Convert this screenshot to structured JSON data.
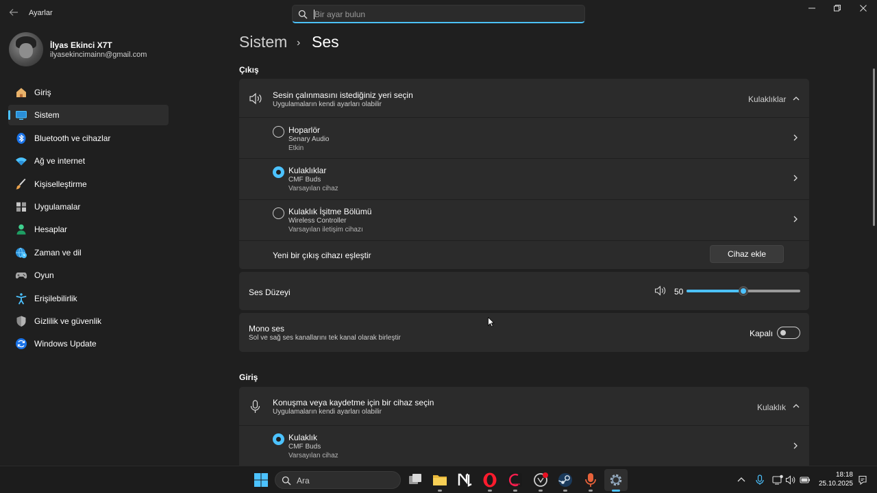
{
  "app": {
    "title": "Ayarlar",
    "back_icon": "back-arrow-icon",
    "window_controls": [
      "minimize",
      "maximize",
      "close"
    ]
  },
  "search": {
    "placeholder": "Bir ayar bulun",
    "value": ""
  },
  "profile": {
    "name": "İlyas Ekinci X7T",
    "email": "ilyasekincimainn@gmail.com"
  },
  "sidebar": {
    "items": [
      {
        "label": "Giriş",
        "icon": "home-icon",
        "active": false
      },
      {
        "label": "Sistem",
        "icon": "system-icon",
        "active": true
      },
      {
        "label": "Bluetooth ve cihazlar",
        "icon": "bluetooth-icon",
        "active": false
      },
      {
        "label": "Ağ ve internet",
        "icon": "wifi-icon",
        "active": false
      },
      {
        "label": "Kişiselleştirme",
        "icon": "brush-icon",
        "active": false
      },
      {
        "label": "Uygulamalar",
        "icon": "apps-icon",
        "active": false
      },
      {
        "label": "Hesaplar",
        "icon": "person-icon",
        "active": false
      },
      {
        "label": "Zaman ve dil",
        "icon": "globe-clock-icon",
        "active": false
      },
      {
        "label": "Oyun",
        "icon": "gamepad-icon",
        "active": false
      },
      {
        "label": "Erişilebilirlik",
        "icon": "accessibility-icon",
        "active": false
      },
      {
        "label": "Gizlilik ve güvenlik",
        "icon": "shield-icon",
        "active": false
      },
      {
        "label": "Windows Update",
        "icon": "update-icon",
        "active": false
      }
    ]
  },
  "breadcrumb": {
    "parent": "Sistem",
    "separator": "›",
    "current": "Ses"
  },
  "output": {
    "heading": "Çıkış",
    "chooser": {
      "title": "Sesin çalınmasını istediğiniz yeri seçin",
      "subtitle": "Uygulamaların kendi ayarları olabilir",
      "selected": "Kulaklıklar"
    },
    "devices": [
      {
        "name": "Hoparlör",
        "driver": "Senary Audio",
        "status": "Etkin",
        "selected": false
      },
      {
        "name": "Kulaklıklar",
        "driver": "CMF Buds",
        "status": "Varsayılan cihaz",
        "selected": true
      },
      {
        "name": "Kulaklık İşitme Bölümü",
        "driver": "Wireless Controller",
        "status": "Varsayılan iletişim cihazı",
        "selected": false
      }
    ],
    "pair": {
      "label": "Yeni bir çıkış cihazı eşleştir",
      "button": "Cihaz ekle"
    },
    "volume": {
      "label": "Ses Düzeyi",
      "value": "50",
      "level": 50
    },
    "mono": {
      "title": "Mono ses",
      "subtitle": "Sol ve sağ ses kanallarını tek kanal olarak birleştir",
      "state_label": "Kapalı",
      "on": false
    }
  },
  "input": {
    "heading": "Giriş",
    "chooser": {
      "title": "Konuşma veya kaydetme için bir cihaz seçin",
      "subtitle": "Uygulamaların kendi ayarları olabilir",
      "selected": "Kulaklık"
    },
    "devices": [
      {
        "name": "Kulaklık",
        "driver": "CMF Buds",
        "status": "Varsayılan cihaz",
        "selected": true
      }
    ]
  },
  "taskbar": {
    "search_label": "Ara",
    "apps": [
      "start-icon",
      "task-view-icon",
      "file-explorer-icon",
      "notion-icon",
      "opera-icon",
      "opera-gx-icon",
      "chatgpt-icon",
      "steam-icon",
      "microphone-app-icon",
      "settings-app-icon"
    ],
    "clock": {
      "time": "18:18",
      "date": "25.10.2025"
    }
  },
  "colors": {
    "accent": "#4cc2ff",
    "background": "#1f1f1f",
    "card": "#2b2b2b"
  }
}
